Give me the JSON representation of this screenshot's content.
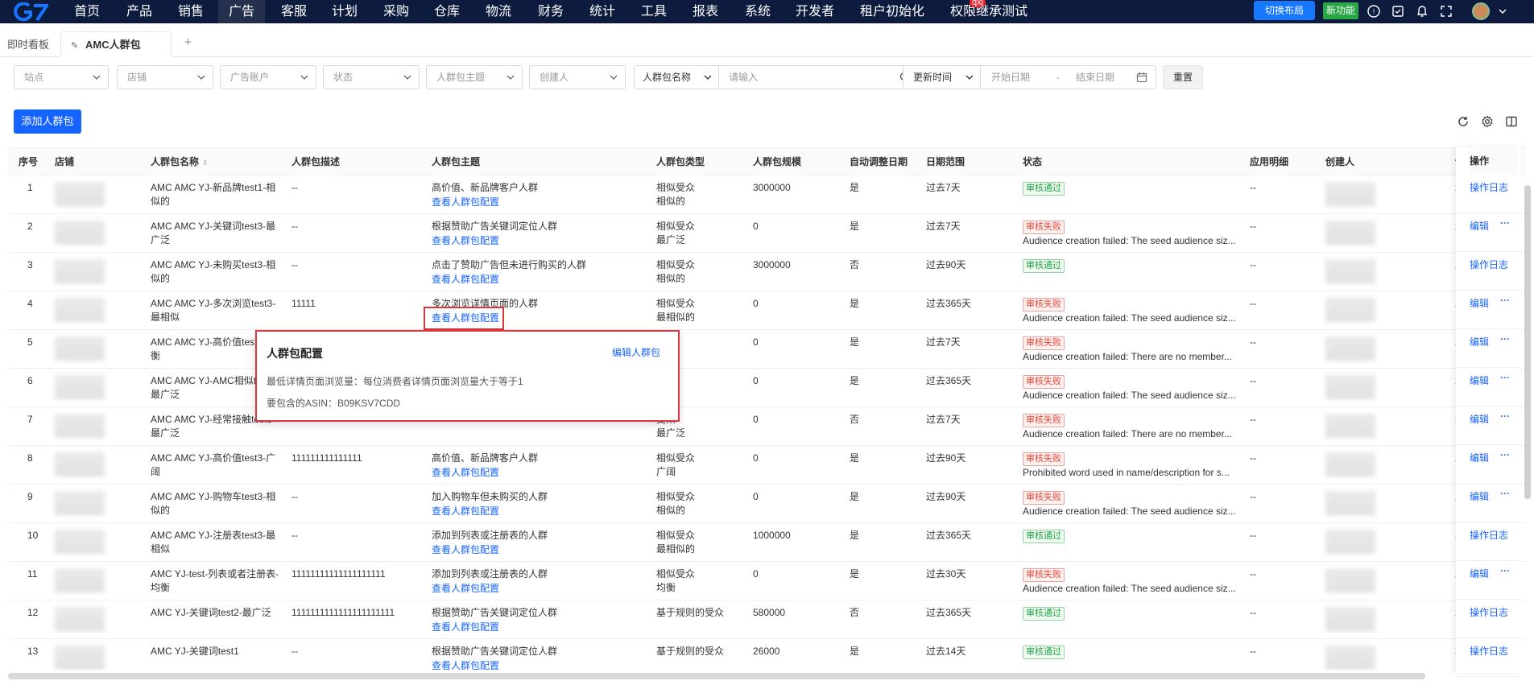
{
  "nav": {
    "items": [
      "首页",
      "产品",
      "销售",
      "广告",
      "客服",
      "计划",
      "采购",
      "仓库",
      "物流",
      "财务",
      "统计",
      "工具",
      "报表",
      "系统",
      "开发者",
      "租户初始化",
      "权限继承测试"
    ],
    "active_index": 3,
    "badge": "qxj",
    "switch_layout": "切换布局",
    "new_feature": "新功能"
  },
  "tabs": {
    "home": "即时看板",
    "current": "AMC人群包",
    "add": "+"
  },
  "filters": {
    "site": "站点",
    "shop": "店铺",
    "ad_account": "广告账户",
    "status": "状态",
    "theme": "人群包主题",
    "creator": "创建人",
    "name_field": "人群包名称",
    "search_placeholder": "请输入",
    "time_field": "更新时间",
    "start_date": "开始日期",
    "date_sep": "-",
    "end_date": "结束日期",
    "reset": "重置"
  },
  "actions": {
    "add": "添加人群包"
  },
  "table": {
    "headers": {
      "idx": "序号",
      "shop": "店铺",
      "name": "人群包名称",
      "desc": "人群包描述",
      "theme": "人群包主题",
      "type": "人群包类型",
      "size": "人群包规模",
      "auto": "自动调整日期",
      "range": "日期范围",
      "status": "状态",
      "apply": "应用明细",
      "creator": "创建人",
      "op": "操作",
      "created_initial": "创"
    },
    "view_config": "查看人群包配置",
    "log": "操作日志",
    "edit": "编辑",
    "more": "···",
    "rows": [
      {
        "idx": "1",
        "name": "AMC AMC YJ-新品牌test1-相似的",
        "desc": "--",
        "theme": "高价值、新品牌客户人群",
        "type": "相似受众\n相似的",
        "size": "3000000",
        "auto": "是",
        "range": "过去7天",
        "status": "审核通过",
        "ok": true,
        "reason": "",
        "apply": "--",
        "created": "2"
      },
      {
        "idx": "2",
        "name": "AMC AMC YJ-关键词test3-最广泛",
        "desc": "--",
        "theme": "根据赞助广告关键词定位人群",
        "type": "相似受众\n最广泛",
        "size": "0",
        "auto": "是",
        "range": "过去7天",
        "status": "审核失败",
        "ok": false,
        "reason": "Audience creation failed: The seed audience siz...",
        "apply": "--",
        "created": "2"
      },
      {
        "idx": "3",
        "name": "AMC AMC YJ-未购买test3-相似的",
        "desc": "--",
        "theme": "点击了赞助广告但未进行购买的人群",
        "type": "相似受众\n相似的",
        "size": "3000000",
        "auto": "否",
        "range": "过去90天",
        "status": "审核通过",
        "ok": true,
        "reason": "",
        "apply": "--",
        "created": "2"
      },
      {
        "idx": "4",
        "name": "AMC AMC YJ-多次浏览test3-最相似",
        "desc": "11111",
        "theme": "多次浏览详情页面的人群",
        "type": "相似受众\n最相似的",
        "size": "0",
        "auto": "是",
        "range": "过去365天",
        "status": "审核失败",
        "ok": false,
        "reason": "Audience creation failed: The seed audience siz...",
        "apply": "--",
        "created": "2"
      },
      {
        "idx": "5",
        "name": "AMC AMC YJ-高价值test3-均衡",
        "desc": "",
        "theme": "",
        "type": "受众\n",
        "size": "0",
        "auto": "是",
        "range": "过去7天",
        "status": "审核失败",
        "ok": false,
        "reason": "Audience creation failed: There are no member...",
        "apply": "--",
        "created": "2"
      },
      {
        "idx": "6",
        "name": "AMC AMC YJ-AMC相似test3-最广泛",
        "desc": "",
        "theme": "",
        "type": "受众\n泛",
        "size": "0",
        "auto": "是",
        "range": "过去365天",
        "status": "审核失败",
        "ok": false,
        "reason": "Audience creation failed: The seed audience siz...",
        "apply": "--",
        "created": "2"
      },
      {
        "idx": "7",
        "name": "AMC AMC YJ-经常接触test3-最广泛",
        "desc": "--",
        "theme": "",
        "type": "受众\n最广泛",
        "size": "0",
        "auto": "否",
        "range": "过去7天",
        "status": "审核失败",
        "ok": false,
        "reason": "Audience creation failed: There are no member...",
        "apply": "--",
        "created": "2"
      },
      {
        "idx": "8",
        "name": "AMC AMC YJ-高价值test3-广阔",
        "desc": "111111111111111",
        "theme": "高价值、新品牌客户人群",
        "type": "相似受众\n广阔",
        "size": "0",
        "auto": "是",
        "range": "过去90天",
        "status": "审核失败",
        "ok": false,
        "reason": "Prohibited word used in name/description for s...",
        "apply": "--",
        "created": "2"
      },
      {
        "idx": "9",
        "name": "AMC AMC YJ-购物车test3-相似的",
        "desc": "--",
        "theme": "加入购物车但未购买的人群",
        "type": "相似受众\n相似的",
        "size": "0",
        "auto": "是",
        "range": "过去90天",
        "status": "审核失败",
        "ok": false,
        "reason": "Audience creation failed: The seed audience siz...",
        "apply": "--",
        "created": "2"
      },
      {
        "idx": "10",
        "name": "AMC AMC YJ-注册表test3-最相似",
        "desc": "--",
        "theme": "添加到列表或注册表的人群",
        "type": "相似受众\n最相似的",
        "size": "1000000",
        "auto": "是",
        "range": "过去365天",
        "status": "审核通过",
        "ok": true,
        "reason": "",
        "apply": "--",
        "created": "2"
      },
      {
        "idx": "11",
        "name": "AMC YJ-test-列表或者注册表-均衡",
        "desc": "11111111111111111111",
        "theme": "添加到列表或注册表的人群",
        "type": "相似受众\n均衡",
        "size": "0",
        "auto": "是",
        "range": "过去30天",
        "status": "审核失败",
        "ok": false,
        "reason": "Audience creation failed: The seed audience siz...",
        "apply": "--",
        "created": "2"
      },
      {
        "idx": "12",
        "name": "AMC YJ-关键词test2-最广泛",
        "desc": "1111111111111111111111",
        "theme": "根据赞助广告关键词定位人群",
        "type": "基于规则的受众",
        "size": "580000",
        "auto": "否",
        "range": "过去365天",
        "status": "审核通过",
        "ok": true,
        "reason": "",
        "apply": "--",
        "created": "2"
      },
      {
        "idx": "13",
        "name": "AMC YJ-关键词test1",
        "desc": "--",
        "theme": "根据赞助广告关键词定位人群",
        "type": "基于规则的受众",
        "size": "26000",
        "auto": "是",
        "range": "过去14天",
        "status": "审核通过",
        "ok": true,
        "reason": "",
        "apply": "--",
        "created": "2"
      }
    ]
  },
  "popover": {
    "title": "人群包配置",
    "edit": "编辑人群包",
    "line1": "最低详情页面浏览量：每位消费者详情页面浏览量大于等于1",
    "line2": "要包含的ASIN：B09KSV7CDD"
  }
}
